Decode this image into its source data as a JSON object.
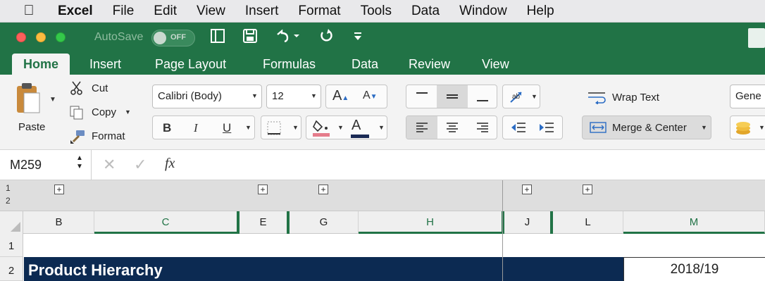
{
  "menubar": {
    "app_name": "Excel",
    "items": [
      "File",
      "Edit",
      "View",
      "Insert",
      "Format",
      "Tools",
      "Data",
      "Window",
      "Help"
    ]
  },
  "titlebar": {
    "autosave_label": "AutoSave",
    "autosave_state": "OFF"
  },
  "ribbon_tabs": [
    "Home",
    "Insert",
    "Page Layout",
    "Formulas",
    "Data",
    "Review",
    "View"
  ],
  "clipboard": {
    "paste": "Paste",
    "cut": "Cut",
    "copy": "Copy",
    "format": "Format"
  },
  "font": {
    "family": "Calibri (Body)",
    "size": "12",
    "bold": "B",
    "italic": "I",
    "underline": "U",
    "grow": "A",
    "shrink": "A",
    "font_color_letter": "A",
    "fill_color": "#e57c8b",
    "font_color": "#1a2a55"
  },
  "alignment": {
    "wrap_text": "Wrap Text",
    "merge_center": "Merge & Center"
  },
  "number": {
    "format": "Gene"
  },
  "formula_bar": {
    "name_box": "M259",
    "fx": "fx",
    "value": ""
  },
  "outline_levels": [
    "1",
    "2"
  ],
  "columns": [
    "B",
    "C",
    "E",
    "G",
    "H",
    "J",
    "L",
    "M"
  ],
  "rows": [
    "1",
    "2"
  ],
  "cells": {
    "product_hierarchy": "Product Hierarchy",
    "year": "2018/19"
  },
  "colors": {
    "excel_green": "#217346",
    "navy": "#0c2a52"
  }
}
